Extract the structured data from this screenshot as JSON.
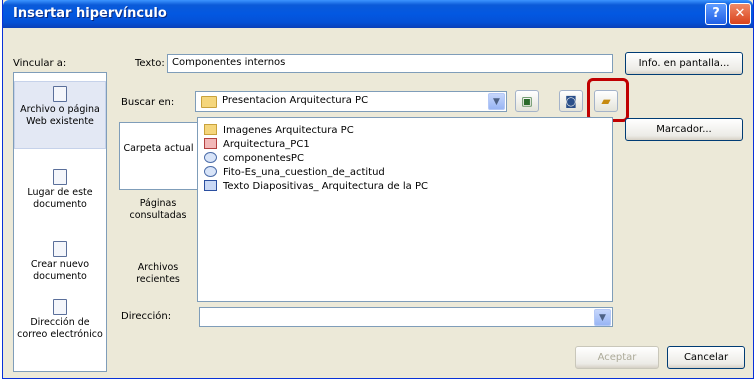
{
  "window": {
    "title": "Insertar hipervínculo",
    "help_glyph": "?",
    "close_glyph": "✕"
  },
  "sidebar": {
    "header": "Vincular a:",
    "items": [
      {
        "label": "Archivo o página Web existente"
      },
      {
        "label": "Lugar de este documento"
      },
      {
        "label": "Crear nuevo documento"
      },
      {
        "label": "Dirección de correo electrónico"
      }
    ]
  },
  "text_field": {
    "label": "Texto:",
    "value": "Componentes internos"
  },
  "buttons": {
    "screentip": "Info. en pantalla...",
    "bookmark": "Marcador...",
    "accept": "Aceptar",
    "cancel": "Cancelar"
  },
  "lookin": {
    "label": "Buscar en:",
    "value": "Presentacion Arquitectura PC"
  },
  "inner_tabs": [
    {
      "label": "Carpeta actual"
    },
    {
      "label": "Páginas consultadas"
    },
    {
      "label": "Archivos recientes"
    }
  ],
  "files": [
    {
      "name": "Imagenes Arquitectura PC",
      "icon": "folder-icon"
    },
    {
      "name": "Arquitectura_PC1",
      "icon": "powerpoint-file-icon"
    },
    {
      "name": "componentesPC",
      "icon": "web-file-icon"
    },
    {
      "name": "Fito-Es_una_cuestion_de_actitud",
      "icon": "web-file-icon"
    },
    {
      "name": "Texto Diapositivas_ Arquitectura de la PC",
      "icon": "word-file-icon"
    }
  ],
  "address": {
    "label": "Dirección:",
    "value": ""
  },
  "colors": {
    "title_bar": "#0358e1",
    "highlight": "#c00000",
    "dialog_bg": "#ece9d8"
  }
}
